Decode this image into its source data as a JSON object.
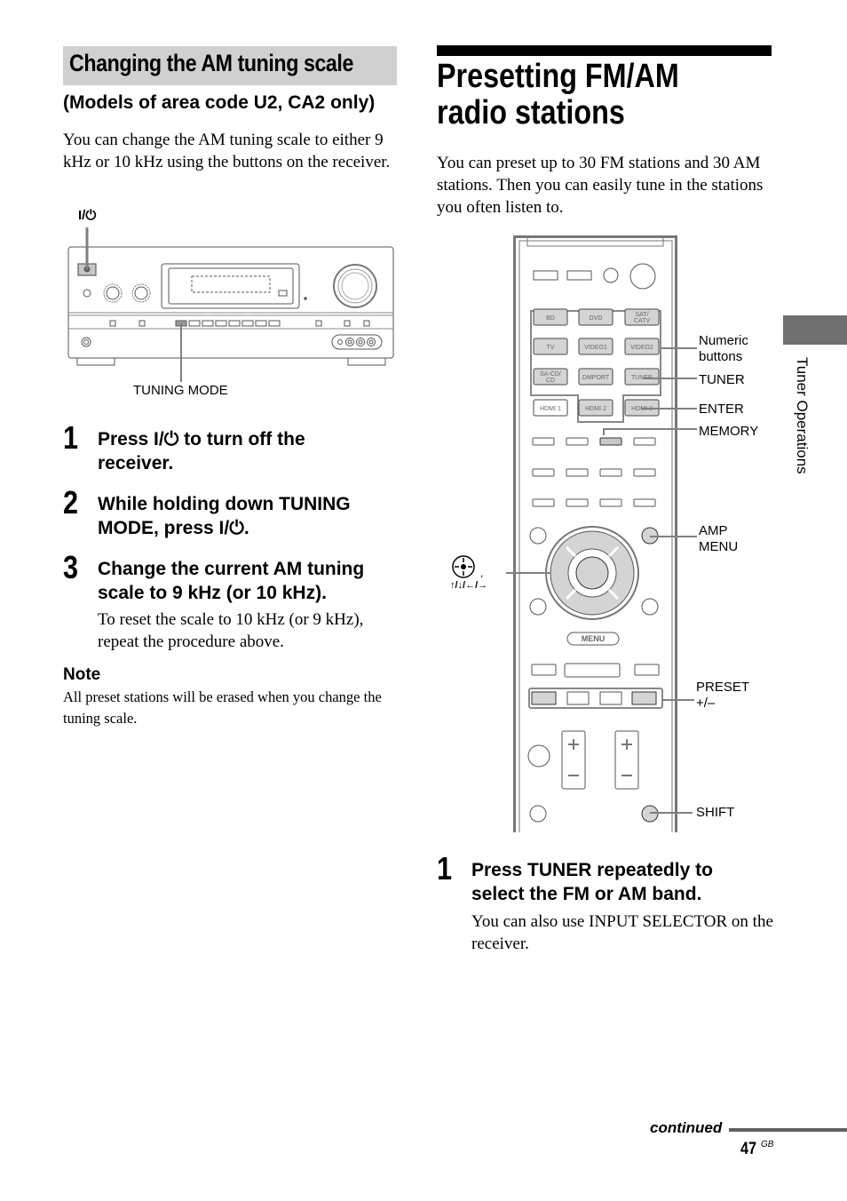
{
  "left": {
    "section_title": "Changing the AM tuning scale",
    "subtitle": "(Models of area code U2, CA2 only)",
    "intro": "You can change the AM tuning scale to either 9 kHz or 10 kHz using the buttons on the receiver.",
    "figure": {
      "power_label": "I/⏻",
      "tuning_mode_label": "TUNING MODE"
    },
    "steps": [
      {
        "number": "1",
        "text": "Press I/⏻ to turn off the receiver."
      },
      {
        "number": "2",
        "text": "While holding down TUNING MODE, press I/⏻."
      },
      {
        "number": "3",
        "text": "Change the current AM tuning scale to 9 kHz (or 10 kHz).",
        "body": "To reset the scale to 10 kHz (or 9 kHz), repeat the procedure above."
      }
    ],
    "note": {
      "heading": "Note",
      "body": "All preset stations will be erased when you change the tuning scale."
    }
  },
  "right": {
    "title": "Presetting FM/AM radio stations",
    "intro": "You can preset up to 30 FM stations and 30 AM stations. Then you can easily tune in the stations you often listen to.",
    "remote": {
      "input_buttons": [
        "BD",
        "DVD",
        "SAT/ CATV",
        "TV",
        "VIDEO1",
        "VIDEO2",
        "SA-CD/ CD",
        "DMPORT",
        "TUNER",
        "HDMI 1",
        "HDMI 2",
        "HDMI 3"
      ],
      "menu_button": "MENU",
      "callouts": {
        "numeric": "Numeric buttons",
        "tuner": "TUNER",
        "enter": "ENTER",
        "memory": "MEMORY",
        "amp_menu": "AMP MENU",
        "preset": "PRESET +/–",
        "shift": "SHIFT",
        "left_symbol_comma": ",",
        "arrows": "↑/↓/←/→"
      }
    },
    "steps": [
      {
        "number": "1",
        "text": "Press TUNER repeatedly to select the FM or AM band.",
        "body": "You can also use INPUT SELECTOR on the receiver."
      }
    ]
  },
  "side_tab": {
    "label": "Tuner Operations"
  },
  "footer": {
    "continued": "continued",
    "page_number": "47",
    "page_suffix": "GB"
  },
  "colors": {
    "section_bar": "#d0d0d0",
    "side_tab": "#707070",
    "line_gray": "#808080",
    "button_fill": "#d4d4d4"
  }
}
